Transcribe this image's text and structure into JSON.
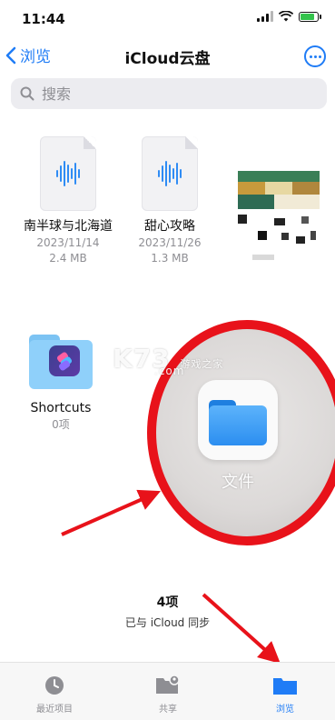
{
  "status_bar": {
    "time": "11:44"
  },
  "nav": {
    "back_label": "浏览",
    "title": "iCloud云盘"
  },
  "search": {
    "placeholder": "搜索"
  },
  "files": [
    {
      "name": "南半球与北海道",
      "date": "2023/11/14",
      "size": "2.4 MB"
    },
    {
      "name": "甜心攻略",
      "date": "2023/11/26",
      "size": "1.3 MB"
    }
  ],
  "folder": {
    "name": "Shortcuts",
    "count": "0项"
  },
  "overlay": {
    "app_label": "文件",
    "watermark": "K73",
    "watermark_sub": "游戏之家",
    "watermark_domain": ".com"
  },
  "footer": {
    "count": "4项",
    "sync": "已与 iCloud 同步"
  },
  "tabs": [
    {
      "label": "最近项目",
      "icon": "clock-icon",
      "active": false
    },
    {
      "label": "共享",
      "icon": "shared-folder-icon",
      "active": false
    },
    {
      "label": "浏览",
      "icon": "folder-icon",
      "active": true
    }
  ],
  "colors": {
    "accent": "#1f7cf6",
    "annotation_red": "#e8121a",
    "battery_green": "#33c34b"
  }
}
